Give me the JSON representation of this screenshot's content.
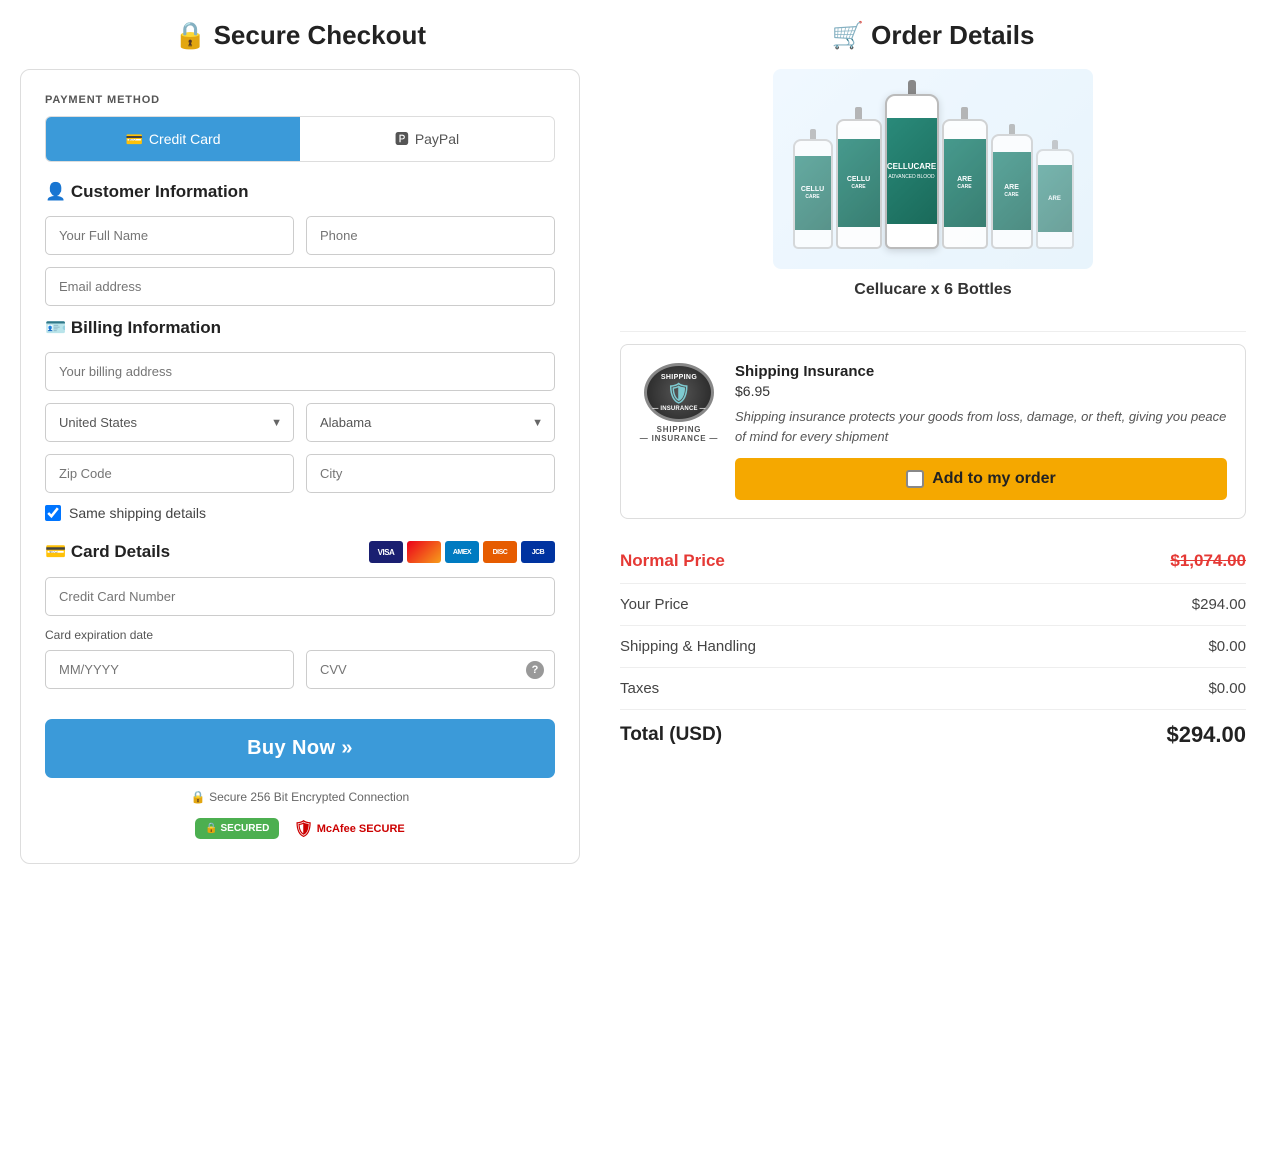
{
  "left": {
    "header": "🔒 Secure Checkout",
    "payment_method_label": "PAYMENT METHOD",
    "tabs": [
      {
        "id": "credit-card",
        "label": "Credit Card",
        "active": true,
        "icon": "💳"
      },
      {
        "id": "paypal",
        "label": "PayPal",
        "active": false,
        "icon": "🅿"
      }
    ],
    "customer_info_title": "👤 Customer Information",
    "fields": {
      "full_name_placeholder": "Your Full Name",
      "phone_placeholder": "Phone",
      "email_placeholder": "Email address",
      "billing_address_placeholder": "Your billing address",
      "zip_placeholder": "Zip Code",
      "city_placeholder": "City"
    },
    "countries": [
      "United States"
    ],
    "states": [
      "Alabama"
    ],
    "billing_title": "🪪 Billing Information",
    "same_shipping_label": "Same shipping details",
    "card_details_title": "💳 Card Details",
    "card_number_placeholder": "Credit Card Number",
    "expiry_label": "Card expiration date",
    "expiry_placeholder": "MM/YYYY",
    "cvv_placeholder": "CVV",
    "buy_btn_label": "Buy Now »",
    "secure_text": "🔒 Secure 256 Bit Encrypted Connection",
    "badge_secured": "🔒 SECURED",
    "badge_mcafee": "McAfee SECURE",
    "card_logos": [
      {
        "name": "visa",
        "label": "VISA"
      },
      {
        "name": "mastercard",
        "label": "MC"
      },
      {
        "name": "amex",
        "label": "AMEX"
      },
      {
        "name": "discover",
        "label": "DISC"
      },
      {
        "name": "jcb",
        "label": "JCB"
      }
    ]
  },
  "right": {
    "header": "🛒 Order Details",
    "product_name": "Cellucare x 6 Bottles",
    "insurance": {
      "title": "Shipping Insurance",
      "price": "$6.95",
      "description": "Shipping insurance protects your goods from loss, damage, or theft, giving you peace of mind for every shipment",
      "add_btn_label": "Add to my order",
      "badge_top": "SHIPPING",
      "badge_middle": "🛡",
      "badge_bottom": "— INSURANCE —"
    },
    "pricing": {
      "normal_price_label": "Normal Price",
      "normal_price_value": "$1,074.00",
      "your_price_label": "Your Price",
      "your_price_value": "$294.00",
      "shipping_label": "Shipping & Handling",
      "shipping_value": "$0.00",
      "taxes_label": "Taxes",
      "taxes_value": "$0.00",
      "total_label": "Total (USD)",
      "total_value": "$294.00"
    },
    "bottles": [
      {
        "size": "small"
      },
      {
        "size": "medium"
      },
      {
        "size": "large"
      },
      {
        "size": "medium"
      },
      {
        "size": "small"
      },
      {
        "size": "xsmall"
      }
    ]
  }
}
